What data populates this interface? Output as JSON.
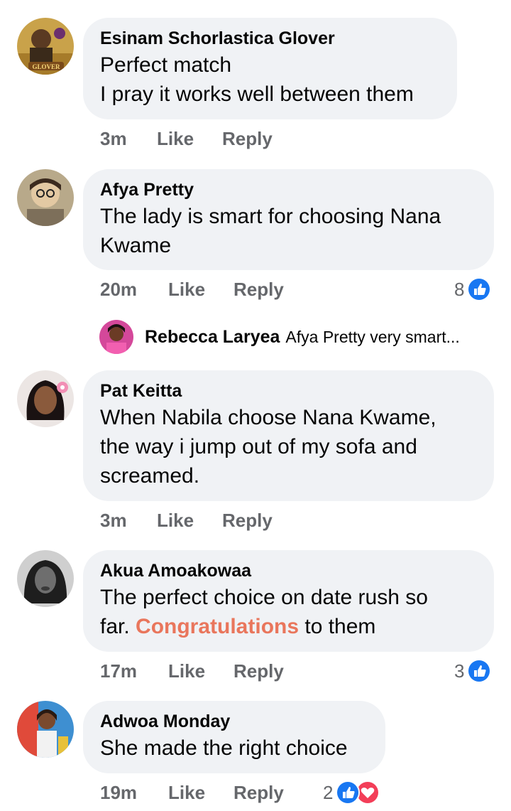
{
  "comments": [
    {
      "author": "Esinam Schorlastica Glover",
      "lines": [
        "Perfect match",
        "I pray it works well between them"
      ],
      "time": "3m",
      "like": "Like",
      "reply": "Reply",
      "avatar_badge": "GLOVER"
    },
    {
      "author": "Afya Pretty",
      "lines": [
        "The lady is smart for choosing Nana",
        "Kwame"
      ],
      "time": "20m",
      "like": "Like",
      "reply": "Reply",
      "reaction_count": "8"
    },
    {
      "author": "Pat Keitta",
      "lines": [
        "When Nabila choose Nana Kwame,",
        "the way i jump out of my sofa and",
        "screamed."
      ],
      "time": "3m",
      "like": "Like",
      "reply": "Reply"
    },
    {
      "author": "Akua Amoakowaa",
      "line1": "The perfect choice on date rush so",
      "line2_pre": "far. ",
      "line2_hl": "Congratulations",
      "line2_post": " to them",
      "time": "17m",
      "like": "Like",
      "reply": "Reply",
      "reaction_count": "3"
    },
    {
      "author": "Adwoa Monday",
      "lines": [
        "She made the right choice"
      ],
      "time": "19m",
      "like": "Like",
      "reply": "Reply",
      "reaction_count": "2"
    }
  ],
  "reply_preview": {
    "author": "Rebecca Laryea",
    "text": "Afya Pretty very smart..."
  },
  "colors": {
    "bubble": "#f0f2f5",
    "meta": "#65676b",
    "like_blue": "#1877f2",
    "love_red": "#f33e58",
    "highlight": "#e9765c"
  },
  "icons": [
    "like-reaction-icon",
    "love-reaction-icon"
  ]
}
